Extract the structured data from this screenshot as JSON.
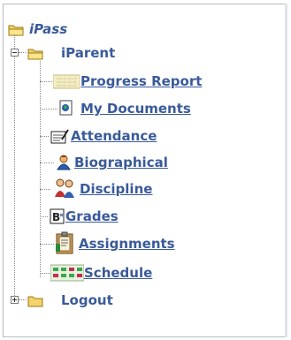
{
  "tree": {
    "root_label": "iPass",
    "parent_label": "iParent",
    "items": [
      {
        "label": "Progress Report",
        "icon": "progress-report-icon"
      },
      {
        "label": "My Documents",
        "icon": "documents-icon"
      },
      {
        "label": "Attendance",
        "icon": "attendance-icon"
      },
      {
        "label": "Biographical",
        "icon": "biographical-icon"
      },
      {
        "label": "Discipline",
        "icon": "discipline-icon"
      },
      {
        "label": "Grades",
        "icon": "grades-icon"
      },
      {
        "label": "Assignments",
        "icon": "assignments-icon"
      },
      {
        "label": "Schedule",
        "icon": "schedule-icon"
      }
    ],
    "logout_label": "Logout"
  },
  "colors": {
    "link": "#3a5a9a",
    "folder": "#f3d36a",
    "folder_outline": "#9a7a1a",
    "border": "#b6bcc6"
  }
}
